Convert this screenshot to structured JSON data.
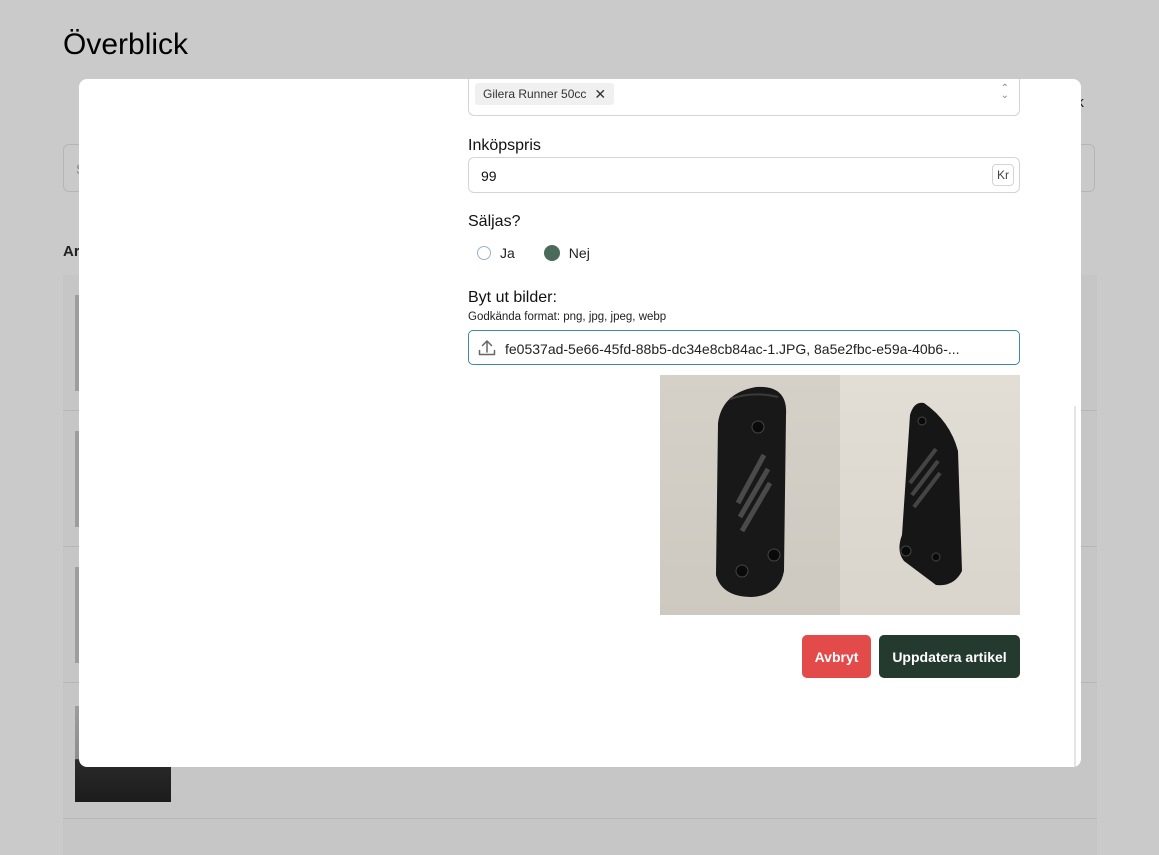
{
  "background": {
    "page_title": "Överblick",
    "user_partial": "uk",
    "search_partial": "S",
    "section_partial": "Ar"
  },
  "modal": {
    "models": {
      "selected_chip": "Gilera Runner 50cc"
    },
    "price": {
      "label": "Inköpspris",
      "value": "99",
      "unit": "Kr"
    },
    "for_sale": {
      "label": "Säljas?",
      "options": [
        "Ja",
        "Nej"
      ],
      "selected": "Nej"
    },
    "images": {
      "label": "Byt ut bilder:",
      "hint": "Godkända format: png, jpg, jpeg, webp",
      "file_value": "fe0537ad-5e66-45fd-88b5-dc34e8cb84ac-1.JPG, 8a5e2fbc-e59a-40b6-..."
    },
    "buttons": {
      "cancel": "Avbryt",
      "submit": "Uppdatera artikel"
    }
  },
  "colors": {
    "overlay_bg": "#cacaca",
    "cancel": "#e34a4a",
    "submit": "#243a2f",
    "radio_selected": "#4a6b5b",
    "file_border": "#3f8aa0"
  }
}
